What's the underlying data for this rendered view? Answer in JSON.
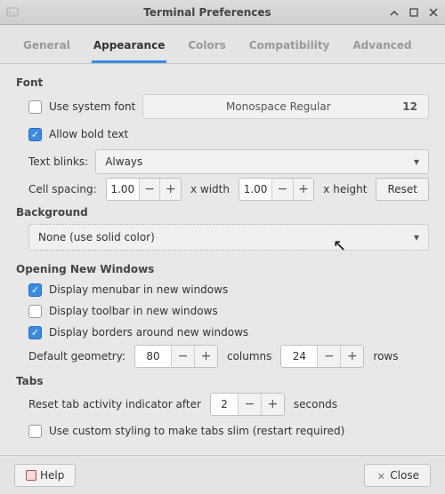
{
  "window": {
    "title": "Terminal Preferences"
  },
  "tabs": [
    "General",
    "Appearance",
    "Colors",
    "Compatibility",
    "Advanced"
  ],
  "active_tab": "Appearance",
  "sections": {
    "font": {
      "title": "Font",
      "use_system_font_label": "Use system font",
      "use_system_font_checked": false,
      "font_name": "Monospace Regular",
      "font_size": "12",
      "allow_bold_label": "Allow bold text",
      "allow_bold_checked": true,
      "text_blinks_label": "Text blinks:",
      "text_blinks_value": "Always",
      "cell_spacing_label": "Cell spacing:",
      "width_value": "1.00",
      "width_suffix": "x width",
      "height_value": "1.00",
      "height_suffix": "x height",
      "reset_label": "Reset"
    },
    "background": {
      "title": "Background",
      "mode_value": "None (use solid color)"
    },
    "new_windows": {
      "title": "Opening New Windows",
      "menubar_label": "Display menubar in new windows",
      "menubar_checked": true,
      "toolbar_label": "Display toolbar in new windows",
      "toolbar_checked": false,
      "borders_label": "Display borders around new windows",
      "borders_checked": true,
      "geometry_label": "Default geometry:",
      "columns_value": "80",
      "columns_suffix": "columns",
      "rows_value": "24",
      "rows_suffix": "rows"
    },
    "tabs_section": {
      "title": "Tabs",
      "reset_activity_label": "Reset tab activity indicator after",
      "reset_activity_value": "2",
      "reset_activity_suffix": "seconds",
      "slim_tabs_label": "Use custom styling to make tabs slim (restart required)",
      "slim_tabs_checked": false
    }
  },
  "footer": {
    "help_label": "Help",
    "close_label": "Close"
  }
}
